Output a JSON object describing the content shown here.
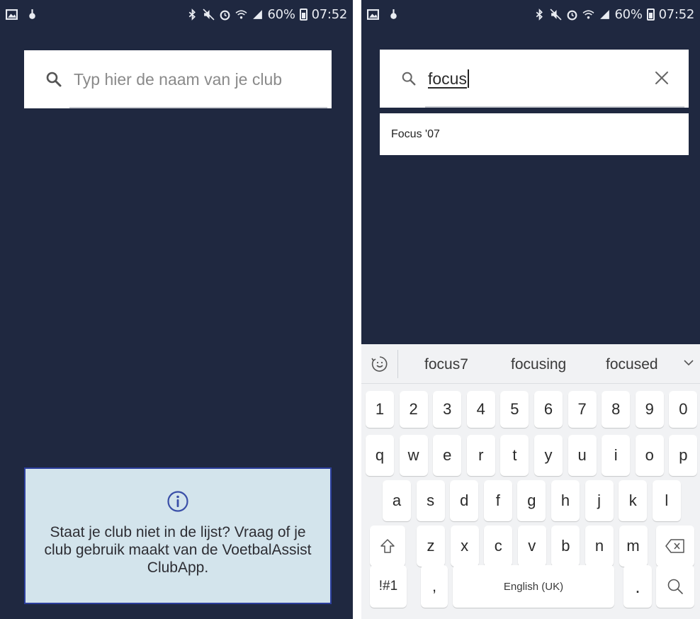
{
  "left_screen": {
    "status": {
      "battery": "60%",
      "time": "07:52"
    },
    "search": {
      "placeholder": "Typ hier de naam van je club"
    },
    "info": {
      "text": "Staat je club niet in de lijst? Vraag of je club gebruik maakt van de VoetbalAssist ClubApp."
    }
  },
  "right_screen": {
    "status": {
      "battery": "60%",
      "time": "07:52"
    },
    "search": {
      "value": "focus"
    },
    "results": [
      {
        "label": "Focus '07"
      }
    ],
    "keyboard": {
      "suggestions": [
        "focus7",
        "focusing",
        "focused"
      ],
      "number_row": [
        "1",
        "2",
        "3",
        "4",
        "5",
        "6",
        "7",
        "8",
        "9",
        "0"
      ],
      "row1": [
        "q",
        "w",
        "e",
        "r",
        "t",
        "y",
        "u",
        "i",
        "o",
        "p"
      ],
      "row2": [
        "a",
        "s",
        "d",
        "f",
        "g",
        "h",
        "j",
        "k",
        "l"
      ],
      "row3": [
        "z",
        "x",
        "c",
        "v",
        "b",
        "n",
        "m"
      ],
      "symbols_label": "!#1",
      "comma_label": ",",
      "space_label": "English (UK)",
      "period_label": "."
    }
  },
  "colors": {
    "background": "#1f2840",
    "info_bg": "#d3e4ec",
    "info_border": "#2c3f9e"
  },
  "icons": [
    "image-icon",
    "notification-icon",
    "bluetooth-icon",
    "mute-icon",
    "alarm-icon",
    "wifi-icon",
    "signal-icon",
    "battery-icon",
    "search-icon",
    "close-icon",
    "info-icon",
    "emoji-icon",
    "chevron-down-icon",
    "shift-icon",
    "backspace-icon"
  ]
}
